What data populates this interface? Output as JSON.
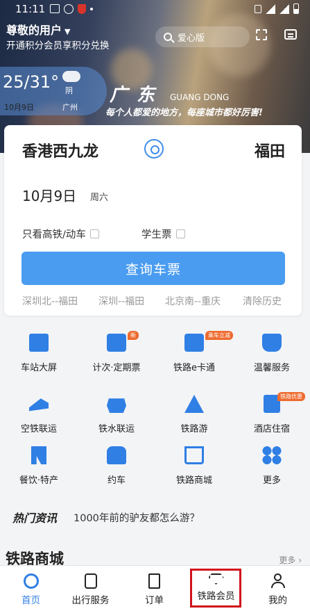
{
  "status": {
    "time": "11:11"
  },
  "header": {
    "user_title": "尊敬的用户",
    "user_sub": "开通积分会员享积分兑换",
    "search_label": "爱心版"
  },
  "weather": {
    "temp": "25/31°",
    "condition": "阴",
    "date": "10月9日",
    "city": "广州"
  },
  "banner": {
    "slogan_big": "广  东",
    "slogan_en": "GUANG DONG",
    "slogan_small": "每个人都爱的地方，每座城市都好厉害!"
  },
  "ticket": {
    "from": "香港西九龙",
    "to": "福田",
    "date": "10月9日",
    "weekday": "周六",
    "opt_highspeed": "只看高铁/动车",
    "opt_student": "学生票",
    "query_label": "查询车票",
    "history": [
      "深圳北--福田",
      "深圳--福田",
      "北京南--重庆",
      "清除历史"
    ]
  },
  "services": [
    {
      "label": "车站大屏"
    },
    {
      "label": "计次·定期票",
      "badge": "新"
    },
    {
      "label": "铁路e卡通",
      "badge": "乘车立减"
    },
    {
      "label": "温馨服务"
    },
    {
      "label": "空铁联运"
    },
    {
      "label": "铁水联运"
    },
    {
      "label": "铁路游"
    },
    {
      "label": "酒店住宿",
      "badge": "铁路优惠"
    },
    {
      "label": "餐饮·特产"
    },
    {
      "label": "约车"
    },
    {
      "label": "铁路商城"
    },
    {
      "label": "更多"
    }
  ],
  "news": {
    "title": "热门资讯",
    "headline": "1000年前的驴友都怎么游？"
  },
  "mall": {
    "title": "铁路商城",
    "more": "更多"
  },
  "tabs": [
    {
      "label": "首页"
    },
    {
      "label": "出行服务"
    },
    {
      "label": "订单"
    },
    {
      "label": "铁路会员"
    },
    {
      "label": "我的"
    }
  ],
  "colors": {
    "accent": "#2f7fe4",
    "highlight": "#d0121b"
  }
}
